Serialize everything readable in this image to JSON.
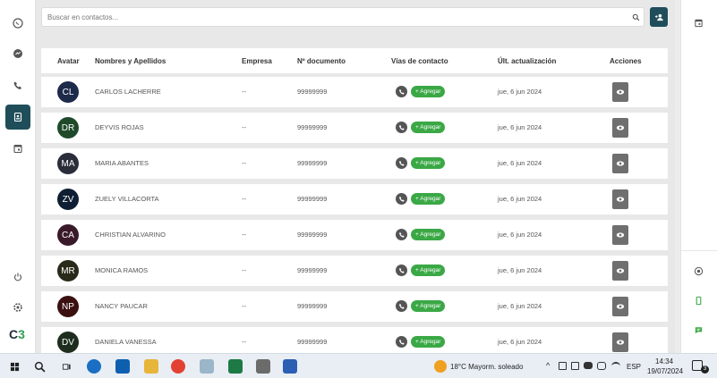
{
  "left_rail": {
    "icons": [
      "whatsapp-icon",
      "messenger-icon",
      "phone-icon",
      "contacts-icon",
      "calendar-icon"
    ],
    "bottom_icons": [
      "power-icon",
      "settings-icon"
    ],
    "logo_c": "C",
    "logo_3": "3"
  },
  "search": {
    "placeholder": "Buscar en contactos..."
  },
  "table": {
    "headers": {
      "avatar": "Avatar",
      "name": "Nombres y Apellidos",
      "company": "Empresa",
      "document": "Nº documento",
      "contact": "Vías de contacto",
      "updated": "Últ. actualización",
      "actions": "Acciones"
    },
    "rows": [
      {
        "initials": "CL",
        "name": "CARLOS LACHERRE",
        "company": "--",
        "document": "99999999",
        "add_label": "+ Agregar",
        "updated": "jue, 6 jun 2024",
        "avatar_color": "#1d2a4a"
      },
      {
        "initials": "DR",
        "name": "DEYVIS ROJAS",
        "company": "--",
        "document": "99999999",
        "add_label": "+ Agregar",
        "updated": "jue, 6 jun 2024",
        "avatar_color": "#1e4a2a"
      },
      {
        "initials": "MA",
        "name": "MARIA ABANTES",
        "company": "--",
        "document": "99999999",
        "add_label": "+ Agregar",
        "updated": "jue, 6 jun 2024",
        "avatar_color": "#2a2d3a"
      },
      {
        "initials": "ZV",
        "name": "ZUELY VILLACORTA",
        "company": "--",
        "document": "99999999",
        "add_label": "+ Agregar",
        "updated": "jue, 6 jun 2024",
        "avatar_color": "#0f1f33"
      },
      {
        "initials": "CA",
        "name": "CHRISTIAN ALVARINO",
        "company": "--",
        "document": "99999999",
        "add_label": "+ Agregar",
        "updated": "jue, 6 jun 2024",
        "avatar_color": "#3a1a2a"
      },
      {
        "initials": "MR",
        "name": "MONICA RAMOS",
        "company": "--",
        "document": "99999999",
        "add_label": "+ Agregar",
        "updated": "jue, 6 jun 2024",
        "avatar_color": "#2a2a1a"
      },
      {
        "initials": "NP",
        "name": "NANCY PAUCAR",
        "company": "--",
        "document": "99999999",
        "add_label": "+ Agregar",
        "updated": "jue, 6 jun 2024",
        "avatar_color": "#3a1010"
      },
      {
        "initials": "DV",
        "name": "DANIELA VANESSA",
        "company": "--",
        "document": "99999999",
        "add_label": "+ Agregar",
        "updated": "jue, 6 jun 2024",
        "avatar_color": "#1e2e1e"
      }
    ]
  },
  "right_rail": {
    "icons": [
      "calendar-icon",
      "target-icon",
      "mobile-icon",
      "chat-icon"
    ]
  },
  "taskbar": {
    "weather": "18°C  Mayorm. soleado",
    "language": "ESP",
    "time": "14:34",
    "date": "19/07/2024",
    "notifications": "3"
  },
  "colors": {
    "accent": "#1f4e5a",
    "green": "#3aa845",
    "view_btn": "#6f6f6f"
  }
}
